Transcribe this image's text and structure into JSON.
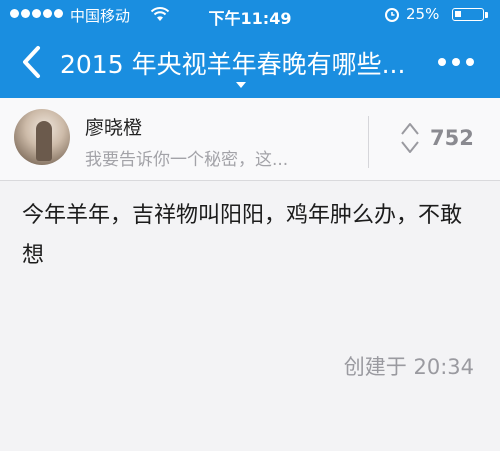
{
  "status_bar": {
    "carrier": "中国移动",
    "time": "下午11:49",
    "battery_percent": "25%",
    "battery_level": 0.25
  },
  "nav": {
    "title": "2015 年央视羊年春晚有哪些...",
    "back_icon": "chevron-left-icon",
    "more_icon": "more-dots-icon"
  },
  "contact": {
    "name": "廖晓橙",
    "preview": "我要告诉你一个秘密，这...",
    "vote_count": "752"
  },
  "message": {
    "text": "今年羊年，吉祥物叫阳阳，鸡年肿么办，不敢想",
    "created": "创建于 20:34"
  },
  "colors": {
    "header": "#1a8ee0",
    "background": "#f3f3f5"
  }
}
